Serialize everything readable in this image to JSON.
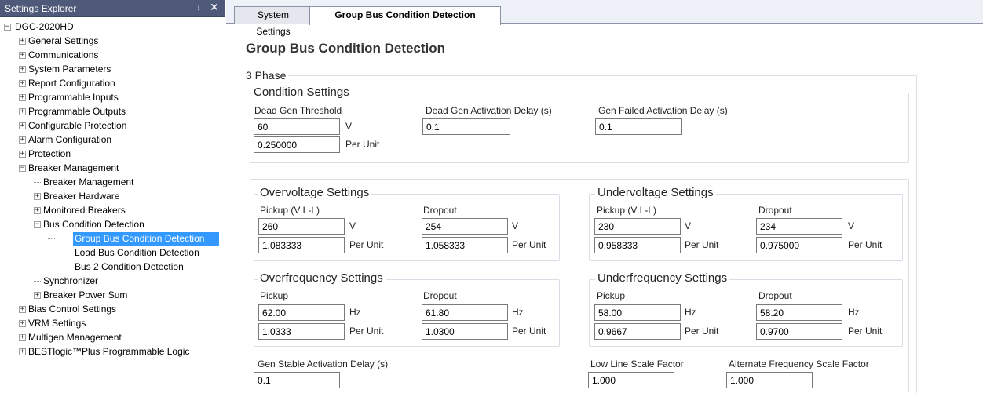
{
  "panel": {
    "title": "Settings Explorer",
    "pin_glyph": "⭭",
    "close_glyph": "✕"
  },
  "tree": {
    "root": "DGC-2020HD",
    "items": [
      "General Settings",
      "Communications",
      "System Parameters",
      "Report Configuration",
      "Programmable Inputs",
      "Programmable Outputs",
      "Configurable Protection",
      "Alarm Configuration",
      "Protection",
      "Breaker Management",
      "Breaker Management",
      "Breaker Hardware",
      "Monitored Breakers",
      "Bus Condition Detection",
      "Group Bus Condition Detection",
      "Load Bus Condition Detection",
      "Bus 2 Condition Detection",
      "Synchronizer",
      "Breaker Power Sum",
      "Bias Control Settings",
      "VRM Settings",
      "Multigen Management",
      "BESTlogic™Plus Programmable Logic"
    ],
    "plus": "+",
    "minus": "−"
  },
  "tabs": {
    "system": "System Settings",
    "group": "Group Bus Condition Detection"
  },
  "page": {
    "title": "Group Bus Condition Detection"
  },
  "three_phase": {
    "title": "3 Phase"
  },
  "condition": {
    "title": "Condition Settings",
    "dead_gen_threshold_label": "Dead Gen Threshold",
    "dead_gen_threshold_value": "60",
    "dead_gen_threshold_unit": "V",
    "dead_gen_threshold_pu": "0.250000",
    "per_unit": "Per Unit",
    "dead_gen_delay_label": "Dead Gen Activation Delay (s)",
    "dead_gen_delay_value": "0.1",
    "gen_failed_delay_label": "Gen Failed Activation Delay (s)",
    "gen_failed_delay_value": "0.1"
  },
  "overvoltage": {
    "title": "Overvoltage Settings",
    "pickup_label": "Pickup (V L-L)",
    "pickup_value": "260",
    "pickup_unit": "V",
    "pickup_pu": "1.083333",
    "dropout_label": "Dropout",
    "dropout_value": "254",
    "dropout_unit": "V",
    "dropout_pu": "1.058333",
    "per_unit": "Per Unit"
  },
  "undervoltage": {
    "title": "Undervoltage Settings",
    "pickup_label": "Pickup (V L-L)",
    "pickup_value": "230",
    "pickup_unit": "V",
    "pickup_pu": "0.958333",
    "dropout_label": "Dropout",
    "dropout_value": "234",
    "dropout_unit": "V",
    "dropout_pu": "0.975000",
    "per_unit": "Per Unit"
  },
  "overfrequency": {
    "title": "Overfrequency Settings",
    "pickup_label": "Pickup",
    "pickup_value": "62.00",
    "pickup_unit": "Hz",
    "pickup_pu": "1.0333",
    "dropout_label": "Dropout",
    "dropout_value": "61.80",
    "dropout_unit": "Hz",
    "dropout_pu": "1.0300",
    "per_unit": "Per Unit"
  },
  "underfrequency": {
    "title": "Underfrequency Settings",
    "pickup_label": "Pickup",
    "pickup_value": "58.00",
    "pickup_unit": "Hz",
    "pickup_pu": "0.9667",
    "dropout_label": "Dropout",
    "dropout_value": "58.20",
    "dropout_unit": "Hz",
    "dropout_pu": "0.9700",
    "per_unit": "Per Unit"
  },
  "bottom": {
    "gen_stable_label": "Gen Stable Activation Delay (s)",
    "gen_stable_value": "0.1",
    "low_line_label": "Low Line Scale Factor",
    "low_line_value": "1.000",
    "alt_freq_label": "Alternate Frequency Scale Factor",
    "alt_freq_value": "1.000"
  },
  "colors": {
    "header": "#4f5a7a",
    "selected": "#3399ff"
  }
}
